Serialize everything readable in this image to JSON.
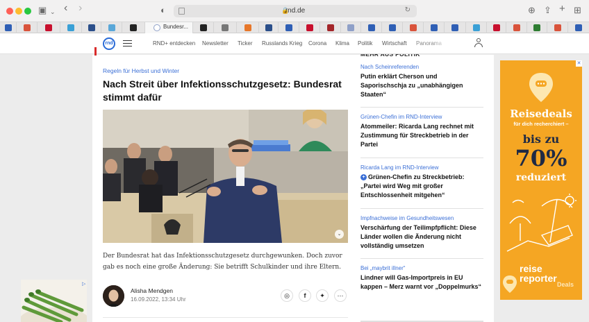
{
  "browser": {
    "domain": "rnd.de",
    "active_tab_label": "Bundesr..."
  },
  "nav": {
    "logo_text": "rnd",
    "items": [
      "RND+ entdecken",
      "Newsletter",
      "Ticker",
      "Russlands Krieg",
      "Corona",
      "Klima",
      "Politik",
      "Wirtschaft",
      "Panorama"
    ]
  },
  "article": {
    "kicker": "Regeln für Herbst und Winter",
    "headline": "Nach Streit über Infektionsschutzgesetz: Bundesrat stimmt dafür",
    "teaser": "Der Bundesrat hat das Infektionsschutzgesetz durchgewunken. Doch zuvor gab es noch eine große Änderung: Sie betrifft Schulkinder und ihre Eltern.",
    "author": "Alisha Mendgen",
    "date": "16.09.2022, 13:34 Uhr"
  },
  "sidebar": {
    "heading": "MEHR AUS POLITIK",
    "items": [
      {
        "kicker": "Nach Scheinreferenden",
        "title": "Putin erklärt Cherson und Saporischschja zu „unabhängigen Staaten“"
      },
      {
        "kicker": "Grünen-Chefin im RND-Interview",
        "title": "Atommeiler: Ricarda Lang rechnet mit Zustimmung für Streckbetrieb in der Partei"
      },
      {
        "kicker": "Ricarda Lang im RND-Interview",
        "title": "Grünen-Chefin zu Streckbetrieb: „Partei wird Weg mit großer Entschlossenheit mitgehen“"
      },
      {
        "kicker": "Impfnachweise im Gesundheitswesen",
        "title": "Verschärfung der Teilimpfpflicht: Diese Länder wollen die Änderung nicht vollständig umsetzen"
      },
      {
        "kicker": "Bei „maybrit illner“",
        "title": "Lindner will Gas-Importpreis in EU kappen – Merz warnt vor „Doppelmurks“"
      }
    ]
  },
  "ad": {
    "title": "Reisedeals",
    "subtitle": "für dich recherchiert –",
    "upto": "bis zu",
    "percent": "70%",
    "reduced": "reduziert",
    "brand_line1": "reise",
    "brand_line2": "reporter",
    "brand_line3": "Deals"
  },
  "colors": {
    "accent": "#3b6fd6",
    "ad_orange": "#f5a623",
    "ad_navy": "#1f2a44"
  }
}
